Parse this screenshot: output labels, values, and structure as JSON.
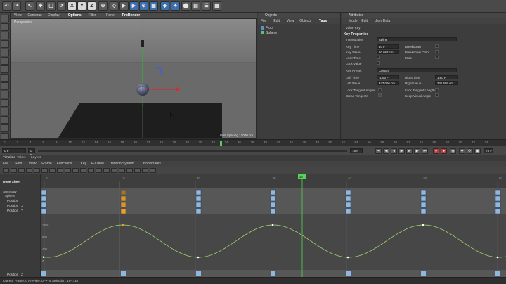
{
  "topbar": {
    "buttons": [
      "↶",
      "↷",
      "↖",
      "✥",
      "▢",
      "⟳",
      "X",
      "Y",
      "Z",
      "⊕",
      "◇",
      "▶",
      "▶",
      "⚙",
      "▦",
      "◆",
      "✦",
      "⬤",
      "▤",
      "☰",
      "▦",
      "◐",
      "☁",
      "⬛"
    ]
  },
  "viewport": {
    "menu": [
      "View",
      "Cameras",
      "Display",
      "Options",
      "Filter",
      "Panel",
      "ProRender"
    ],
    "label": "Perspective",
    "grid_info": "Grid Spacing : 1000 cm"
  },
  "objects": {
    "title": "Objects",
    "menu": [
      "File",
      "Edit",
      "View",
      "Objects",
      "Tags"
    ],
    "rows": [
      {
        "name": "Floor",
        "color": "#5d8fcf"
      },
      {
        "name": "Sphere",
        "color": "#5dc46d"
      }
    ]
  },
  "attributes": {
    "title": "Attributes",
    "menu": [
      "Mode",
      "Edit",
      "User Data"
    ],
    "object_name": "Value Key",
    "section": "Key Properties",
    "interpolation_label": "Interpolation",
    "interpolation_value": "Spline",
    "key_time_label": "Key Time",
    "key_time_value": "10 F",
    "key_value_label": "Key Value",
    "key_value_value": "50.662 cm",
    "lock_time_label": "Lock Time",
    "lock_value_label": "Lock Value",
    "breakdown_label": "Breakdown",
    "breakdown_color_label": "Breakdown Color",
    "mute_label": "Mute",
    "key_preset_label": "Key Preset",
    "key_preset_value": "Custom",
    "left_time_label": "Left Time",
    "left_time_value": "-1.60 F",
    "right_time_label": "Right Time",
    "right_time_value": "1.60 F",
    "left_value_label": "Left Value",
    "left_value_value": "347.066 cm",
    "right_value_label": "Right Value",
    "right_value_value": "341.559 cm",
    "lock_tangent_angles": "Lock Tangent Angles",
    "lock_tangent_lengths": "Lock Tangent Lengths",
    "break_tangents": "Break Tangents",
    "keep_visual_angle": "Keep Visual Angle"
  },
  "ruler": {
    "ticks": [
      "0",
      "2",
      "4",
      "6",
      "8",
      "10",
      "12",
      "14",
      "16",
      "18",
      "20",
      "22",
      "24",
      "26",
      "28",
      "30",
      "32",
      "34",
      "36",
      "38",
      "40",
      "42",
      "44",
      "46",
      "48",
      "50",
      "52",
      "54",
      "56",
      "58",
      "60",
      "62",
      "64",
      "66",
      "68",
      "70",
      "72",
      "74"
    ]
  },
  "playbar": {
    "current_frame": "0 F",
    "start_frame": "0 F",
    "end_frame": "75 F",
    "end_frame2": "75 F"
  },
  "dope": {
    "tabs": [
      "Timeline",
      "Takes",
      "Layers"
    ],
    "menu": [
      "File",
      "Edit",
      "View",
      "Frame",
      "Functions",
      "Key",
      "F-Curve",
      "Motion System",
      "Bookmarks"
    ],
    "title": "Dope Sheet",
    "tracks": [
      "Summary",
      "Sphere",
      "Position",
      "Position . X",
      "Position . Y",
      "Position . Z"
    ],
    "frame_labels": [
      "0",
      "10",
      "20",
      "30",
      "40",
      "50",
      "60"
    ],
    "value_labels": [
      "1200",
      "800",
      "400",
      "0"
    ],
    "frame_indicator": "34"
  },
  "status": {
    "text": "Current Frame: 0    Preview: 0-->75    Selection: 10-->10"
  },
  "colors": {
    "curve": "#9fd26a",
    "key": "#8fb7e0",
    "selected_key": "#f0a020",
    "playhead": "#57d157"
  }
}
